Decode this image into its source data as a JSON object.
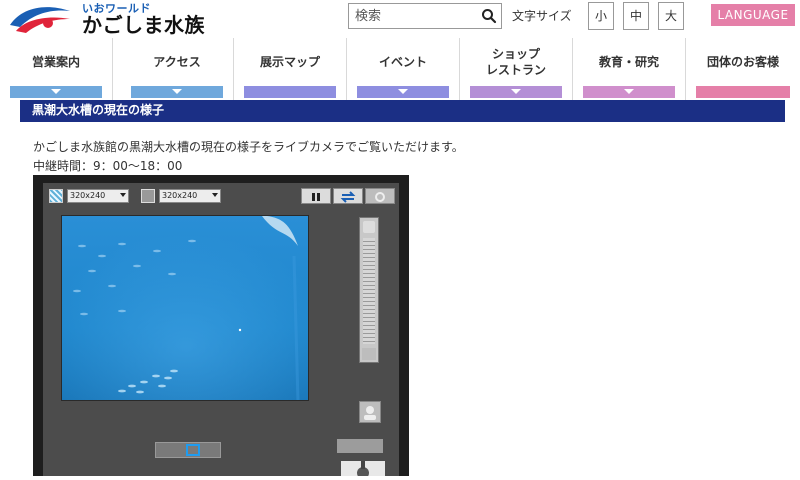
{
  "header": {
    "logo_sub": "いおワールド",
    "logo_main": "かごしま水族館",
    "search_placeholder": "検索",
    "font_size_label": "文字サイズ",
    "font_sizes": [
      "小",
      "中",
      "大"
    ],
    "language_label": "LANGUAGE"
  },
  "nav": {
    "items": [
      {
        "label": "営業案内",
        "color": "#6fa8dc",
        "arrow": true
      },
      {
        "label": "アクセス",
        "color": "#6fa8dc",
        "arrow": true
      },
      {
        "label": "展示マップ",
        "color": "#8e8ee0",
        "arrow": false
      },
      {
        "label": "イベント",
        "color": "#8e8ee0",
        "arrow": true
      },
      {
        "label": "ショップ\nレストラン",
        "color": "#b48fd6",
        "arrow": true
      },
      {
        "label": "教育・研究",
        "color": "#d08fcc",
        "arrow": true
      },
      {
        "label": "団体のお客様",
        "color": "#e57fa8",
        "arrow": false
      }
    ]
  },
  "content": {
    "section_title": "黒潮大水槽の現在の様子",
    "description": "かごしま水族館の黒潮大水槽の現在の様子をライブカメラでご覧いただけます。",
    "hours": "中継時間：9：00〜18：00"
  },
  "viewer": {
    "resolution_1": "320x240",
    "resolution_2": "320x240"
  },
  "colors": {
    "brand_blue": "#1b2f85",
    "language": "#e57fa8",
    "water": "#1b7fc4"
  }
}
